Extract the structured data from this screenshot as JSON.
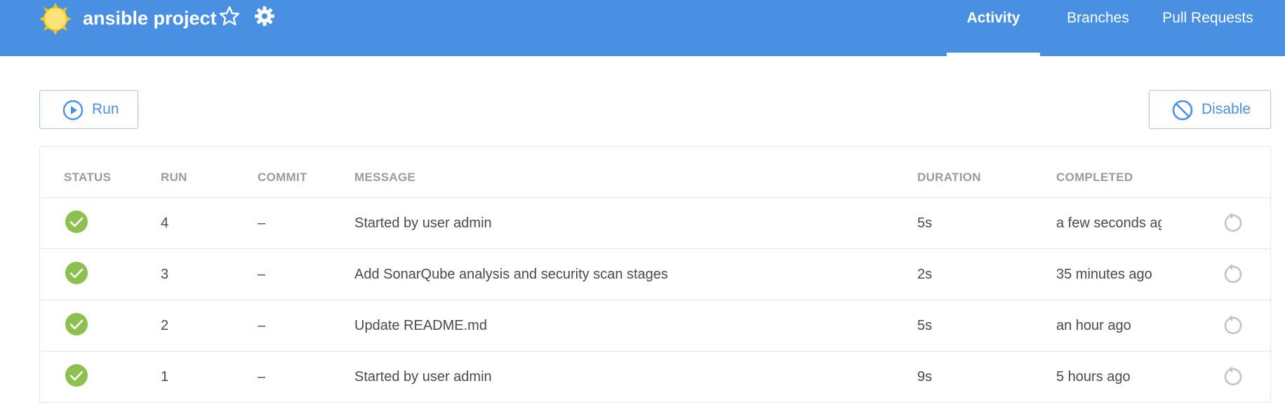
{
  "header": {
    "project_title": "ansible project",
    "tabs": [
      {
        "label": "Activity",
        "active": true
      },
      {
        "label": "Branches",
        "active": false
      },
      {
        "label": "Pull Requests",
        "active": false
      }
    ]
  },
  "toolbar": {
    "run_label": "Run",
    "disable_label": "Disable"
  },
  "table": {
    "columns": [
      "STATUS",
      "RUN",
      "COMMIT",
      "MESSAGE",
      "DURATION",
      "COMPLETED"
    ],
    "rows": [
      {
        "status": "success",
        "run": "4",
        "commit": "–",
        "message": "Started by user admin",
        "duration": "5s",
        "completed": "a few seconds ago"
      },
      {
        "status": "success",
        "run": "3",
        "commit": "–",
        "message": "Add SonarQube analysis and security scan stages",
        "duration": "2s",
        "completed": "35 minutes ago"
      },
      {
        "status": "success",
        "run": "2",
        "commit": "–",
        "message": "Update README.md",
        "duration": "5s",
        "completed": "an hour ago"
      },
      {
        "status": "success",
        "run": "1",
        "commit": "–",
        "message": "Started by user admin",
        "duration": "9s",
        "completed": "5 hours ago"
      }
    ]
  },
  "colors": {
    "header_bg": "#4a90e2",
    "accent": "#4a90e2",
    "success": "#8cc04f",
    "muted": "#9b9b9b"
  },
  "icons": {
    "logo": "sun-logo-icon",
    "favorite": "star-icon",
    "settings": "gear-icon",
    "run": "play-circle-icon",
    "disable": "block-icon",
    "status": "check-circle-icon",
    "rerun": "replay-icon"
  }
}
